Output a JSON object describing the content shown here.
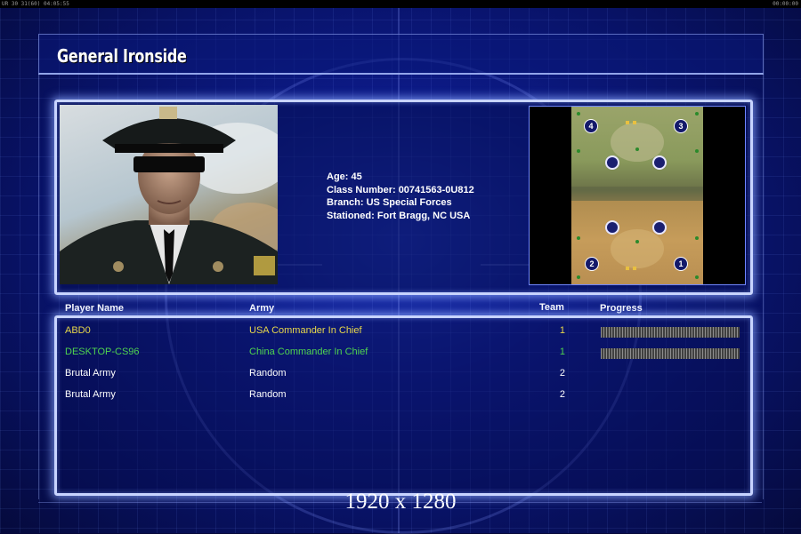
{
  "topbar": {
    "left": "UR 30 31(60) 04:05:55",
    "right": "00:00:00"
  },
  "title": "General Ironside",
  "bio": {
    "age": "Age: 45",
    "class_number": "Class Number: 00741563-0U812",
    "branch": "Branch: US Special Forces",
    "stationed": "Stationed: Fort Bragg, NC USA"
  },
  "minimap": {
    "start_positions": [
      "4",
      "3",
      "2",
      "1"
    ]
  },
  "columns": {
    "player": "Player Name",
    "army": "Army",
    "team": "Team",
    "progress": "Progress"
  },
  "players": [
    {
      "name": "ABD0",
      "army": "USA Commander In Chief",
      "team": "1",
      "color": "#e8d84a",
      "progress": 1.0
    },
    {
      "name": "DESKTOP-CS96",
      "army": "China Commander In Chief",
      "team": "1",
      "color": "#4fd34f",
      "progress": 1.0
    },
    {
      "name": "Brutal Army",
      "army": "Random",
      "team": "2",
      "color": "#ffffff",
      "progress": null
    },
    {
      "name": "Brutal Army",
      "army": "Random",
      "team": "2",
      "color": "#ffffff",
      "progress": null
    }
  ],
  "resolution_label": "1920 x 1280",
  "colors": {
    "panel_border": "#c8d4ff",
    "background": "#0c1a86",
    "team1_player1": "#e8d84a",
    "team1_player2": "#4fd34f"
  }
}
